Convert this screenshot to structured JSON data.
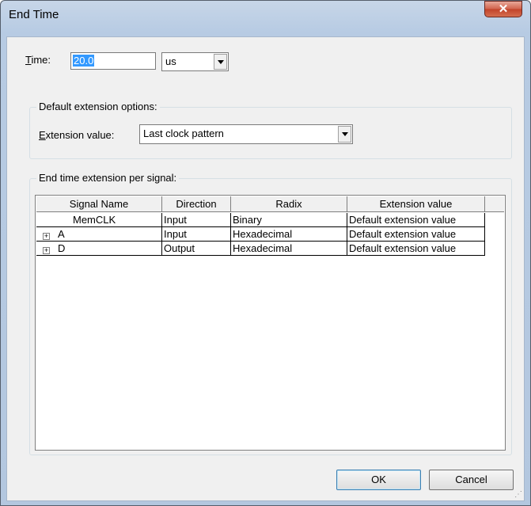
{
  "window": {
    "title": "End Time",
    "close_glyph": "✕"
  },
  "time": {
    "label_accel": "T",
    "label_rest": "ime:",
    "value": "20.0",
    "unit": "us"
  },
  "default_ext": {
    "group_title": "Default extension options:",
    "label_accel": "E",
    "label_rest": "xtension value:",
    "value": "Last clock pattern"
  },
  "per_signal": {
    "group_title": "End time extension per signal:",
    "columns": [
      "Signal Name",
      "Direction",
      "Radix",
      "Extension value"
    ],
    "rows": [
      {
        "expand": "",
        "name": "MemCLK",
        "direction": "Input",
        "radix": "Binary",
        "extension": "Default extension value"
      },
      {
        "expand": "+",
        "name": "A",
        "direction": "Input",
        "radix": "Hexadecimal",
        "extension": "Default extension value"
      },
      {
        "expand": "+",
        "name": "D",
        "direction": "Output",
        "radix": "Hexadecimal",
        "extension": "Default extension value"
      }
    ]
  },
  "buttons": {
    "ok": "OK",
    "cancel": "Cancel"
  },
  "icons": {
    "dropdown": "chevron-down-icon",
    "expand": "plus-box-icon",
    "close": "close-icon"
  }
}
